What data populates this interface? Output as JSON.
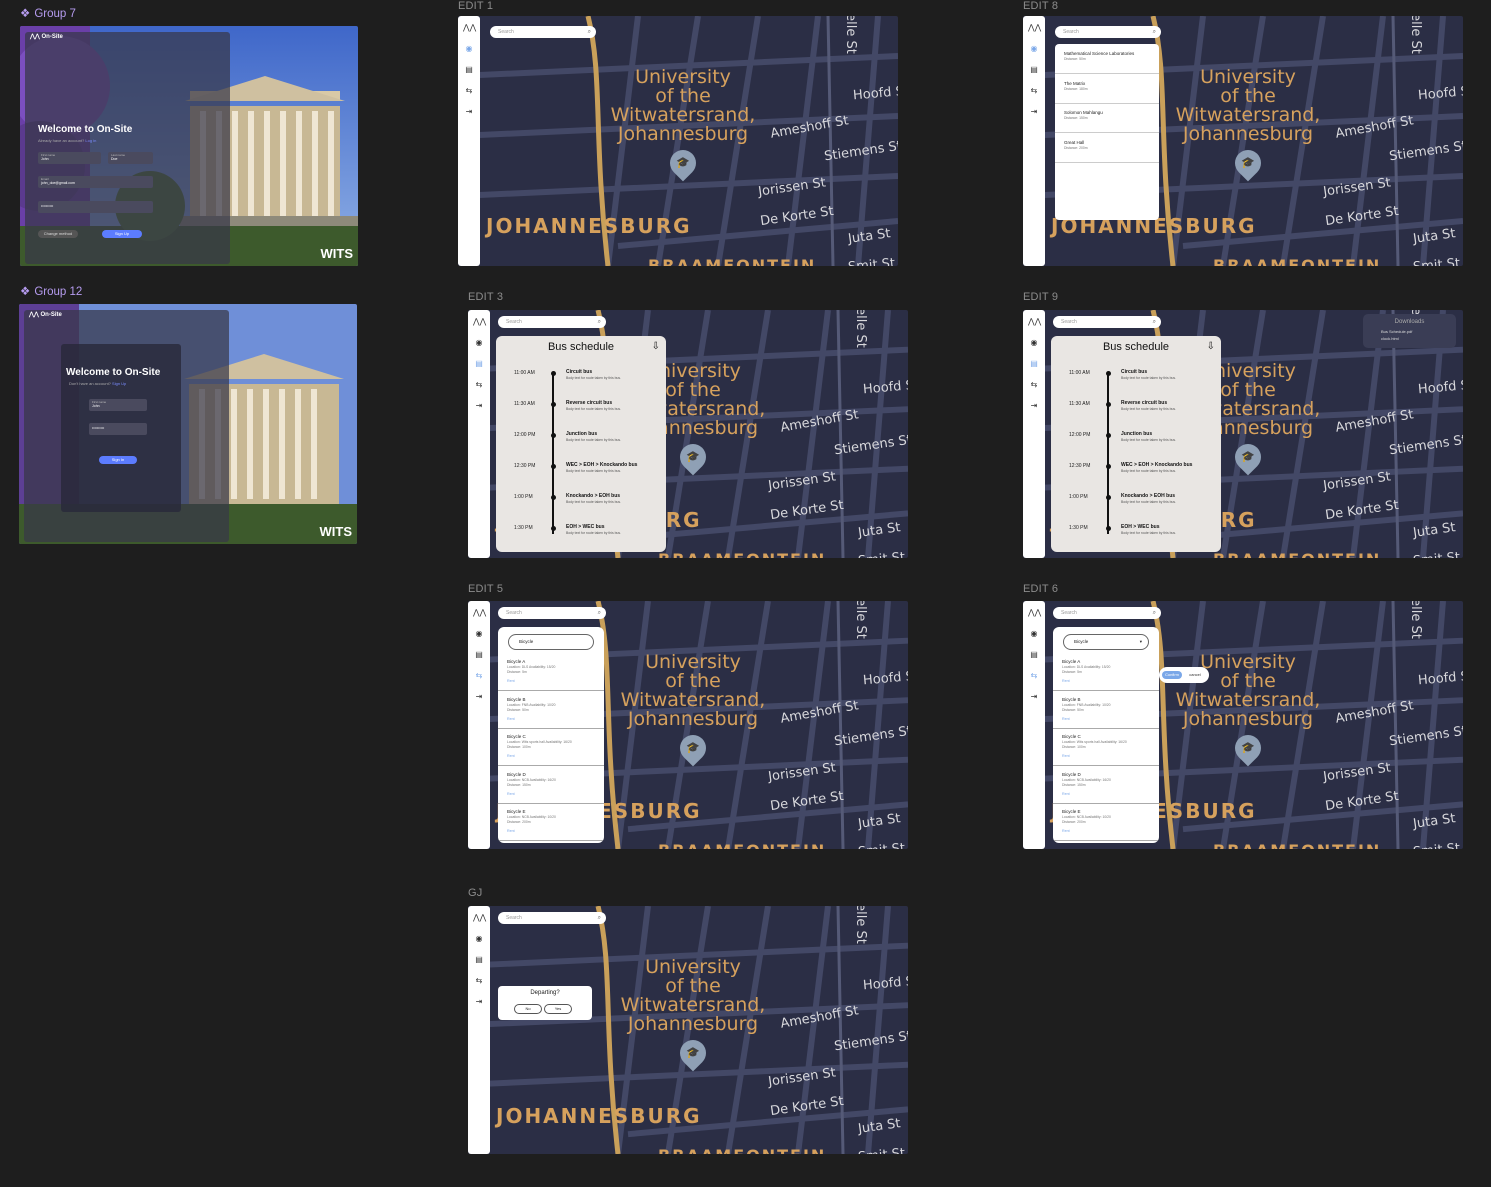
{
  "groups": [
    {
      "label": "Group 7"
    },
    {
      "label": "Group 12"
    }
  ],
  "frames": {
    "edit1": "EDIT 1",
    "edit8": "EDIT 8",
    "edit3": "EDIT 3",
    "edit9": "EDIT 9",
    "edit5": "EDIT 5",
    "edit6": "EDIT 6",
    "gj": "GJ"
  },
  "map": {
    "university": [
      "University",
      "of the",
      "Witwatersrand,",
      "Johannesburg"
    ],
    "city": "JOHANNESBURG",
    "streets": [
      "Hoofd St",
      "Ameshoff St",
      "Stiemens St",
      "Jorissen St",
      "De Korte St",
      "Juta St",
      "Smit St",
      "elle St",
      "BRAAMFONTEIN"
    ]
  },
  "search": {
    "placeholder": "Search"
  },
  "login7": {
    "brand": "On-Site",
    "title": "Welcome to On-Site",
    "subtitle": "Already have an account?",
    "link": "Log in",
    "first_label": "First name",
    "first_value": "John",
    "last_label": "Last name",
    "last_value": "Doe",
    "email_label": "Email",
    "email_value": "john_doe@gmail.com",
    "password_value": "••••••••••",
    "change_method": "Change method",
    "signup": "Sign Up",
    "logo": "WITS"
  },
  "login12": {
    "brand": "On-Site",
    "title": "Welcome to On-Site",
    "subtitle": "Don't have an account?",
    "link": "Sign Up",
    "first_label": "First name",
    "first_value": "John",
    "password_value": "••••••••••",
    "signin": "Sign In",
    "logo": "WITS"
  },
  "search_results": [
    {
      "name": "Mathematical Science Laboratories",
      "dist": "Distance: 50m"
    },
    {
      "name": "The Matrix",
      "dist": "Distance: 180m"
    },
    {
      "name": "Solomon Mahlangu",
      "dist": "Distance: 150m"
    },
    {
      "name": "Great Hall",
      "dist": "Distance: 200m"
    }
  ],
  "schedule": {
    "title": "Bus schedule",
    "rows": [
      {
        "time": "11:00 AM",
        "name": "Circuit bus",
        "body": "Body text for route taken by this bus."
      },
      {
        "time": "11:30 AM",
        "name": "Reverse circuit bus",
        "body": "Body text for route taken by this bus."
      },
      {
        "time": "12:00 PM",
        "name": "Junction bus",
        "body": "Body text for route taken by this bus."
      },
      {
        "time": "12:30 PM",
        "name": "WEC > EOH > Knockando bus",
        "body": "Body text for route taken by this bus."
      },
      {
        "time": "1:00 PM",
        "name": "Knockando > EOH bus",
        "body": "Body text for route taken by this bus."
      },
      {
        "time": "1:30 PM",
        "name": "EOH > WEC bus",
        "body": "Body text for route taken by this bus."
      }
    ]
  },
  "downloads": {
    "title": "Downloads",
    "files": [
      "Bus Schedule.pdf",
      "clock.html"
    ]
  },
  "bicycle": {
    "filter": "Bicycle",
    "rows": [
      {
        "name": "Bicycle A",
        "loc": "Location: DLS  Availability: 15/20",
        "dist": "Distance: 5m",
        "rent": "Rent"
      },
      {
        "name": "Bicycle B",
        "loc": "Location: FNB  Availability: 10/20",
        "dist": "Distance: 50m",
        "rent": "Rent"
      },
      {
        "name": "Bicycle C",
        "loc": "Location: Wits sports hall  Availability: 16/20",
        "dist": "Distance: 100m",
        "rent": "Rent"
      },
      {
        "name": "Bicycle D",
        "loc": "Location: NCB  Availability: 16/20",
        "dist": "Distance: 150m",
        "rent": "Rent"
      },
      {
        "name": "Bicycle E",
        "loc": "Location: NCB  Availability: 10/20",
        "dist": "Distance: 200m",
        "rent": "Rent"
      }
    ],
    "confirm": "Confirm",
    "cancel": "cancel"
  },
  "departing": {
    "question": "Departing?",
    "no": "No",
    "yes": "Yes"
  }
}
